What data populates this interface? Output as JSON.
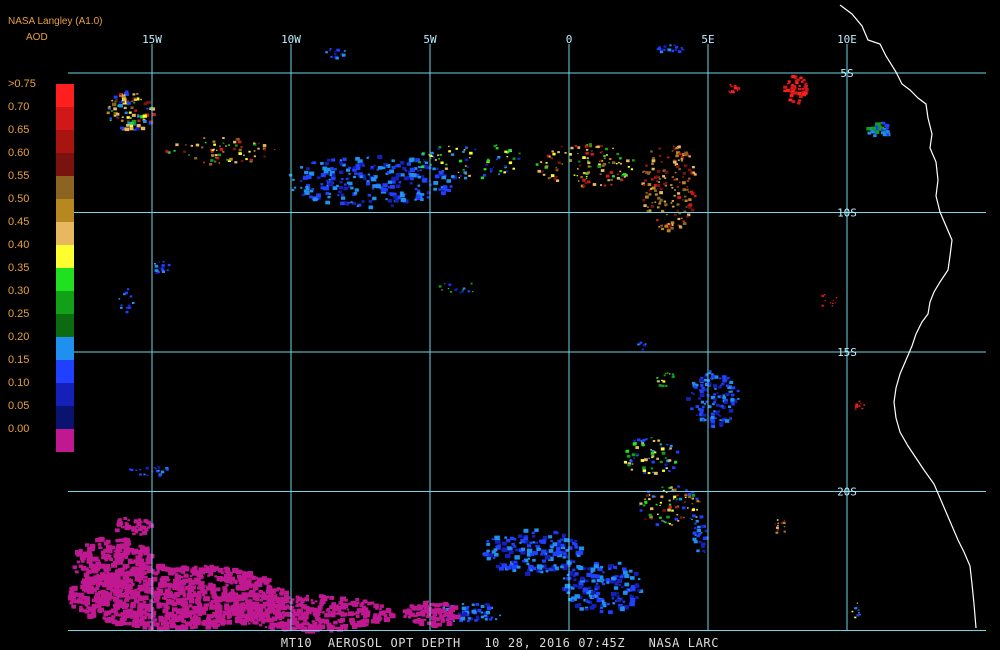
{
  "header": {
    "source": "NASA Langley (A1.0)",
    "product_short": "AOD"
  },
  "footer": {
    "caption": "MT10  AEROSOL OPT DEPTH   10 28, 2016 07:45Z   NASA LARC"
  },
  "map": {
    "lon_range": [
      -17,
      11
    ],
    "lat_range": [
      -23,
      -3
    ],
    "lon_labels": [
      {
        "lon": -15,
        "text": "15W"
      },
      {
        "lon": -10,
        "text": "10W"
      },
      {
        "lon": -5,
        "text": "5W"
      },
      {
        "lon": 0,
        "text": "0"
      },
      {
        "lon": 5,
        "text": "5E"
      },
      {
        "lon": 10,
        "text": "10E"
      }
    ],
    "lat_labels": [
      {
        "lat": -5,
        "text": "5S"
      },
      {
        "lat": -10,
        "text": "10S"
      },
      {
        "lat": -15,
        "text": "15S"
      },
      {
        "lat": -20,
        "text": "20S"
      }
    ],
    "grid_color": "#6ed6e6",
    "coast_color": "#ffffff",
    "background": "#000000"
  },
  "legend": {
    "items": [
      {
        "label": ">0.75",
        "color": "#ff1f1f"
      },
      {
        "label": "0.70",
        "color": "#d01818"
      },
      {
        "label": "0.65",
        "color": "#a81410"
      },
      {
        "label": "0.60",
        "color": "#7a1210"
      },
      {
        "label": "0.55",
        "color": "#8a6420"
      },
      {
        "label": "0.50",
        "color": "#b88820"
      },
      {
        "label": "0.45",
        "color": "#e8b860"
      },
      {
        "label": "0.40",
        "color": "#ffff30"
      },
      {
        "label": "0.35",
        "color": "#20e020"
      },
      {
        "label": "0.30",
        "color": "#12a018"
      },
      {
        "label": "0.25",
        "color": "#0c6a10"
      },
      {
        "label": "0.20",
        "color": "#2090f0"
      },
      {
        "label": "0.15",
        "color": "#2040ff"
      },
      {
        "label": "0.10",
        "color": "#1420b8"
      },
      {
        "label": "0.05",
        "color": "#0a1470"
      },
      {
        "label": "0.00",
        "color": "#c01890"
      }
    ]
  }
}
